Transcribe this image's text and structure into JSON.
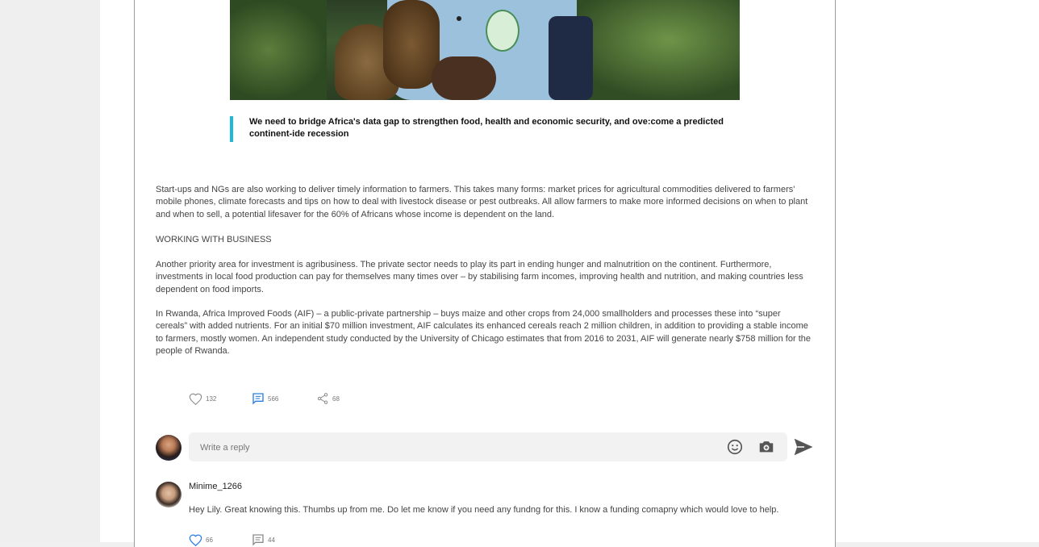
{
  "quote": "We need to bridge Africa's data gap to strengthen food, health and economic security, and ove:come a predicted continent-ide recession",
  "paragraphs": {
    "p1": "Start-ups and NGs are also working to deliver timely information to farmers. This takes many forms: market prices for agricultural commodities delivered to farmers' mobile phones, climate forecasts and tips on how to deal with livestock disease or pest outbreaks. All allow farmers to make more informed decisions on when to plant and when to sell, a potential lifesaver for the 60% of Africans whose income is dependent on the land.",
    "heading": "WORKING WITH BUSINESS",
    "p2": "Another priority area for investment is agribusiness. The private sector needs to play its part in ending hunger and malnutrition on the continent. Furthermore, investments in local food production can pay for themselves many times over – by stabilising farm incomes, improving health and nutrition, and making countries less dependent on food imports.",
    "p3": "In Rwanda, Africa Improved Foods (AIF) – a public-private partnership – buys maize and other crops from 24,000 smallholders and processes these into “super cereals” with added nutrients. For an initial $70 million investment, AIF calculates its enhanced cereals reach 2 million children, in addition to providing a stable income to farmers, mostly women. An independent study conducted by the University of Chicago estimates that from 2016 to 2031, AIF will generate nearly $758 million for the people of Rwanda."
  },
  "post_actions": {
    "likes": "132",
    "comments": "566",
    "shares": "68"
  },
  "reply": {
    "placeholder": "Write a reply"
  },
  "comment": {
    "username": "Minime_1266",
    "text": "Hey Lily. Great knowing this. Thumbs up from me. Do let me know if you need any fundng for this. I know a funding comapny which would love to help.",
    "likes": "66",
    "replies": "44"
  },
  "colors": {
    "accent": "#1fb8d8",
    "link_blue": "#2a7de1"
  }
}
